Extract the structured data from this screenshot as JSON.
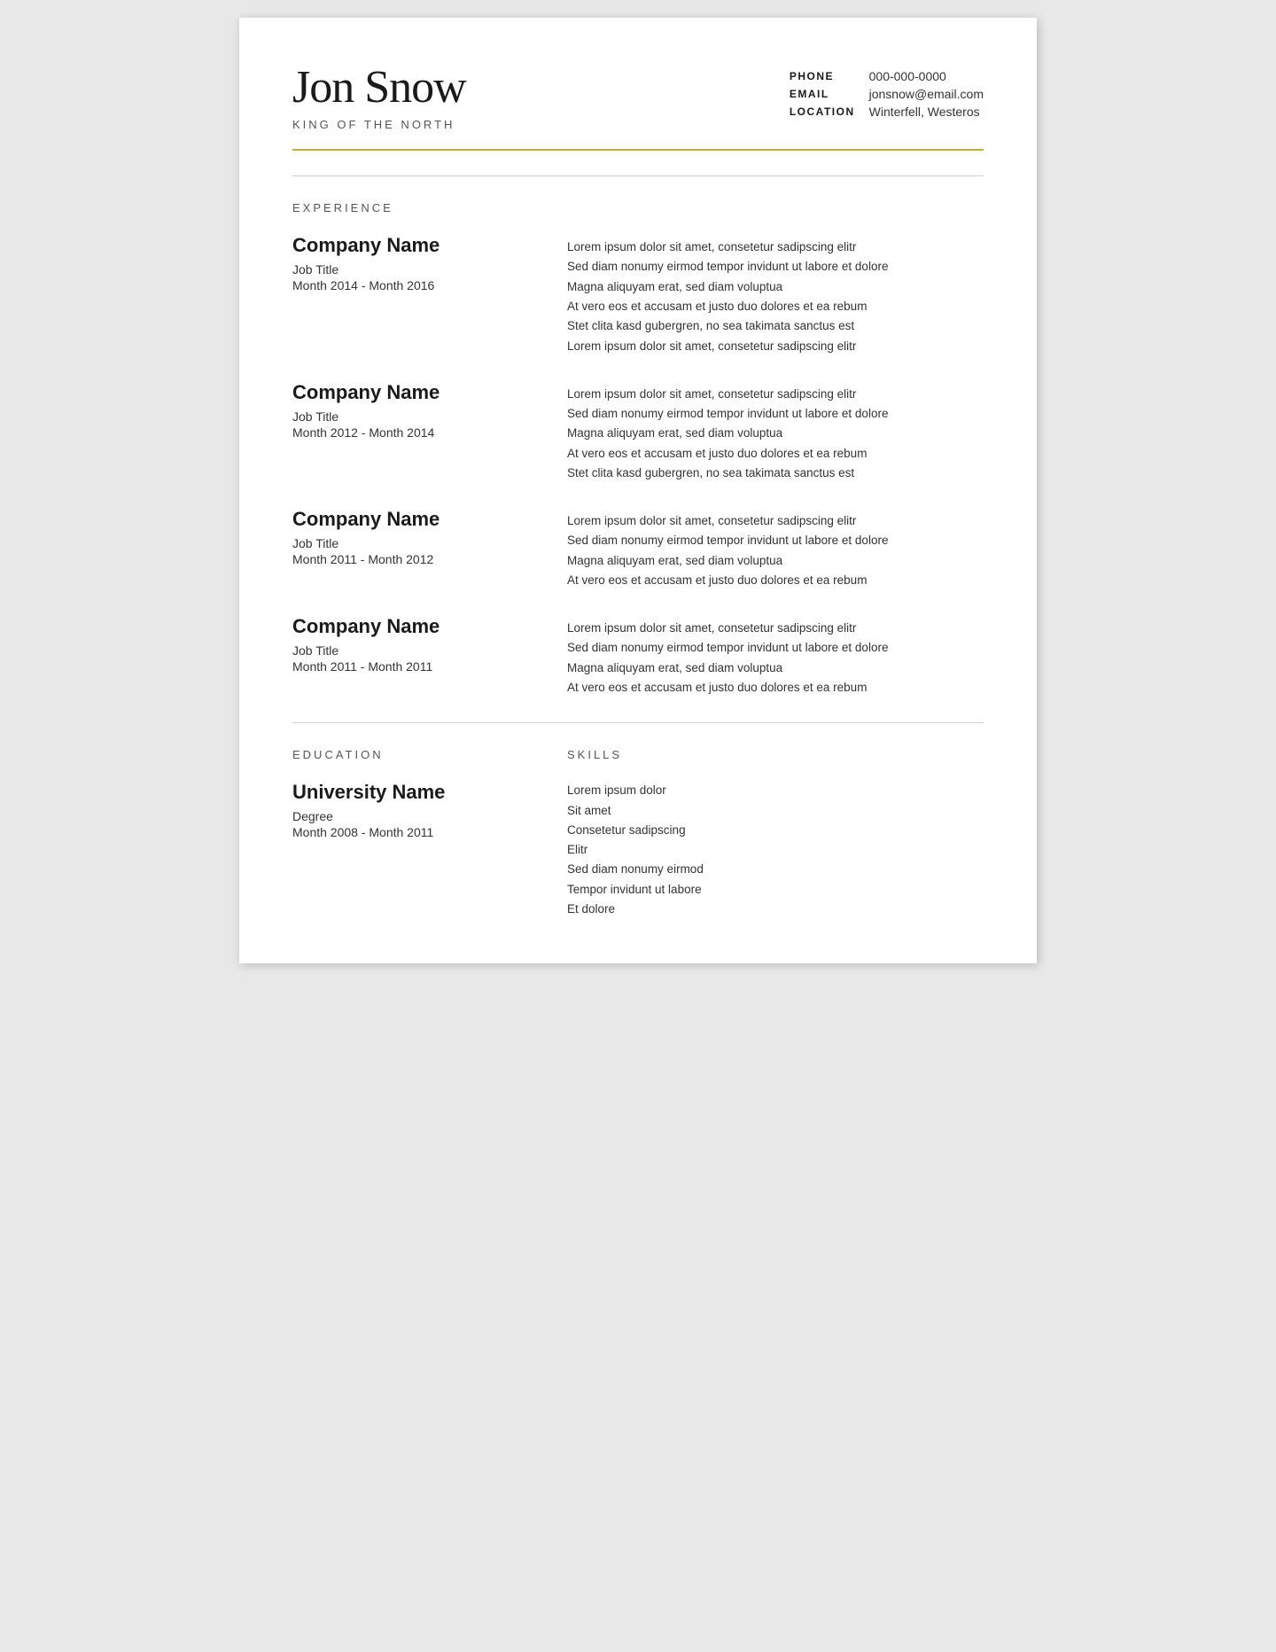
{
  "header": {
    "name": "Jon Snow",
    "subtitle": "KING OF THE NORTH",
    "contact": {
      "phone_label": "PHONE",
      "phone_value": "000-000-0000",
      "email_label": "EMAIL",
      "email_value": "jonsnow@email.com",
      "location_label": "LOCATION",
      "location_value": "Winterfell, Westeros"
    }
  },
  "sections": {
    "experience_title": "EXPERIENCE",
    "education_title": "EDUCATION",
    "skills_title": "SKILLS"
  },
  "experience": [
    {
      "company": "Company Name",
      "job_title": "Job Title",
      "dates": "Month 2014 - Month 2016",
      "description": [
        "Lorem ipsum dolor sit amet, consetetur sadipscing elitr",
        "Sed diam nonumy eirmod tempor invidunt ut labore et dolore",
        "Magna aliquyam erat, sed diam voluptua",
        "At vero eos et accusam et justo duo dolores et ea rebum",
        "Stet clita kasd gubergren, no sea takimata sanctus est",
        "Lorem ipsum dolor sit amet, consetetur sadipscing elitr"
      ]
    },
    {
      "company": "Company Name",
      "job_title": "Job Title",
      "dates": "Month 2012 - Month 2014",
      "description": [
        "Lorem ipsum dolor sit amet, consetetur sadipscing elitr",
        "Sed diam nonumy eirmod tempor invidunt ut labore et dolore",
        "Magna aliquyam erat, sed diam voluptua",
        "At vero eos et accusam et justo duo dolores et ea rebum",
        "Stet clita kasd gubergren, no sea takimata sanctus est"
      ]
    },
    {
      "company": "Company Name",
      "job_title": "Job Title",
      "dates": "Month 2011 - Month 2012",
      "description": [
        "Lorem ipsum dolor sit amet, consetetur sadipscing elitr",
        "Sed diam nonumy eirmod tempor invidunt ut labore et dolore",
        "Magna aliquyam erat, sed diam voluptua",
        "At vero eos et accusam et justo duo dolores et ea rebum"
      ]
    },
    {
      "company": "Company Name",
      "job_title": "Job Title",
      "dates": "Month 2011 - Month 2011",
      "description": [
        "Lorem ipsum dolor sit amet, consetetur sadipscing elitr",
        "Sed diam nonumy eirmod tempor invidunt ut labore et dolore",
        "Magna aliquyam erat, sed diam voluptua",
        "At vero eos et accusam et justo duo dolores et ea rebum"
      ]
    }
  ],
  "education": {
    "university": "University Name",
    "degree": "Degree",
    "dates": "Month 2008 - Month 2011"
  },
  "skills": [
    "Lorem ipsum dolor",
    "Sit amet",
    "Consetetur sadipscing",
    "Elitr",
    "Sed diam nonumy eirmod",
    "Tempor invidunt ut labore",
    "Et dolore"
  ]
}
